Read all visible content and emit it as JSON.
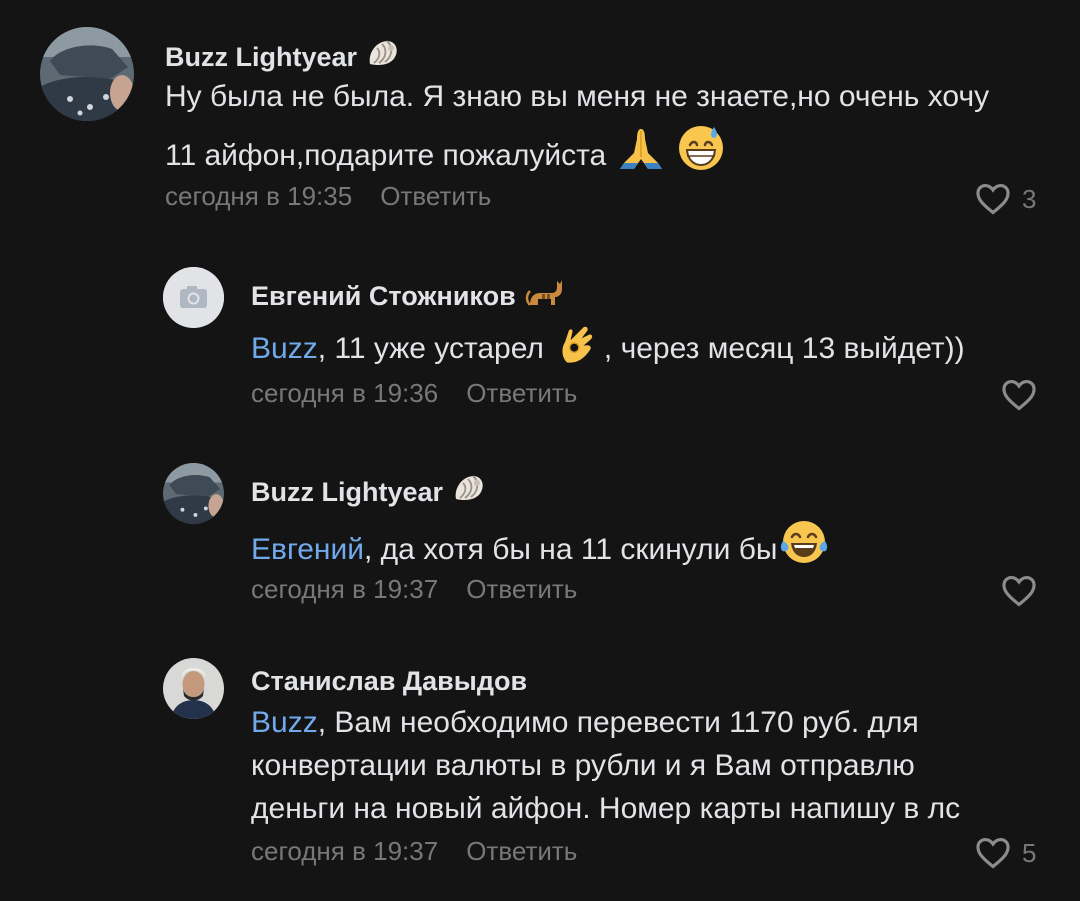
{
  "comments": [
    {
      "author": "Buzz Lightyear",
      "author_badge": "shell-emoji",
      "text": "Ну была не была. Я знаю вы меня не знаете,но очень хочу",
      "text_line2": "11 айфон,подарите пожалуйста",
      "emojis": [
        "folded-hands-emoji",
        "grinning-sweat-emoji"
      ],
      "time": "сегодня в 19:35",
      "reply_label": "Ответить",
      "likes": "3"
    },
    {
      "author": "Евгений Стожников",
      "author_badge": "cat-emoji",
      "mention": "Buzz",
      "text_before_emoji": ", 11 уже устарел",
      "emoji": "ok-hand-emoji",
      "text_after_emoji": ", через месяц 13 выйдет))",
      "time": "сегодня в 19:36",
      "reply_label": "Ответить",
      "likes": ""
    },
    {
      "author": "Buzz Lightyear",
      "author_badge": "shell-emoji",
      "mention": "Евгений",
      "text": ", да хотя бы на 11 скинули бы",
      "emoji": "tears-of-joy-emoji",
      "time": "сегодня в 19:37",
      "reply_label": "Ответить",
      "likes": ""
    },
    {
      "author": "Станислав Давыдов",
      "mention": "Buzz",
      "text_line1": ", Вам необходимо перевести 1170 руб. для",
      "text_line2": "конвертации валюты в рубли и я Вам отправлю",
      "text_line3": "деньги на новый айфон. Номер карты напишу в лс",
      "time": "сегодня в 19:37",
      "reply_label": "Ответить",
      "likes": "5"
    }
  ],
  "colors": {
    "background": "#141414",
    "text": "#e1e3e6",
    "meta": "#76787a",
    "mention": "#71aaeb"
  }
}
